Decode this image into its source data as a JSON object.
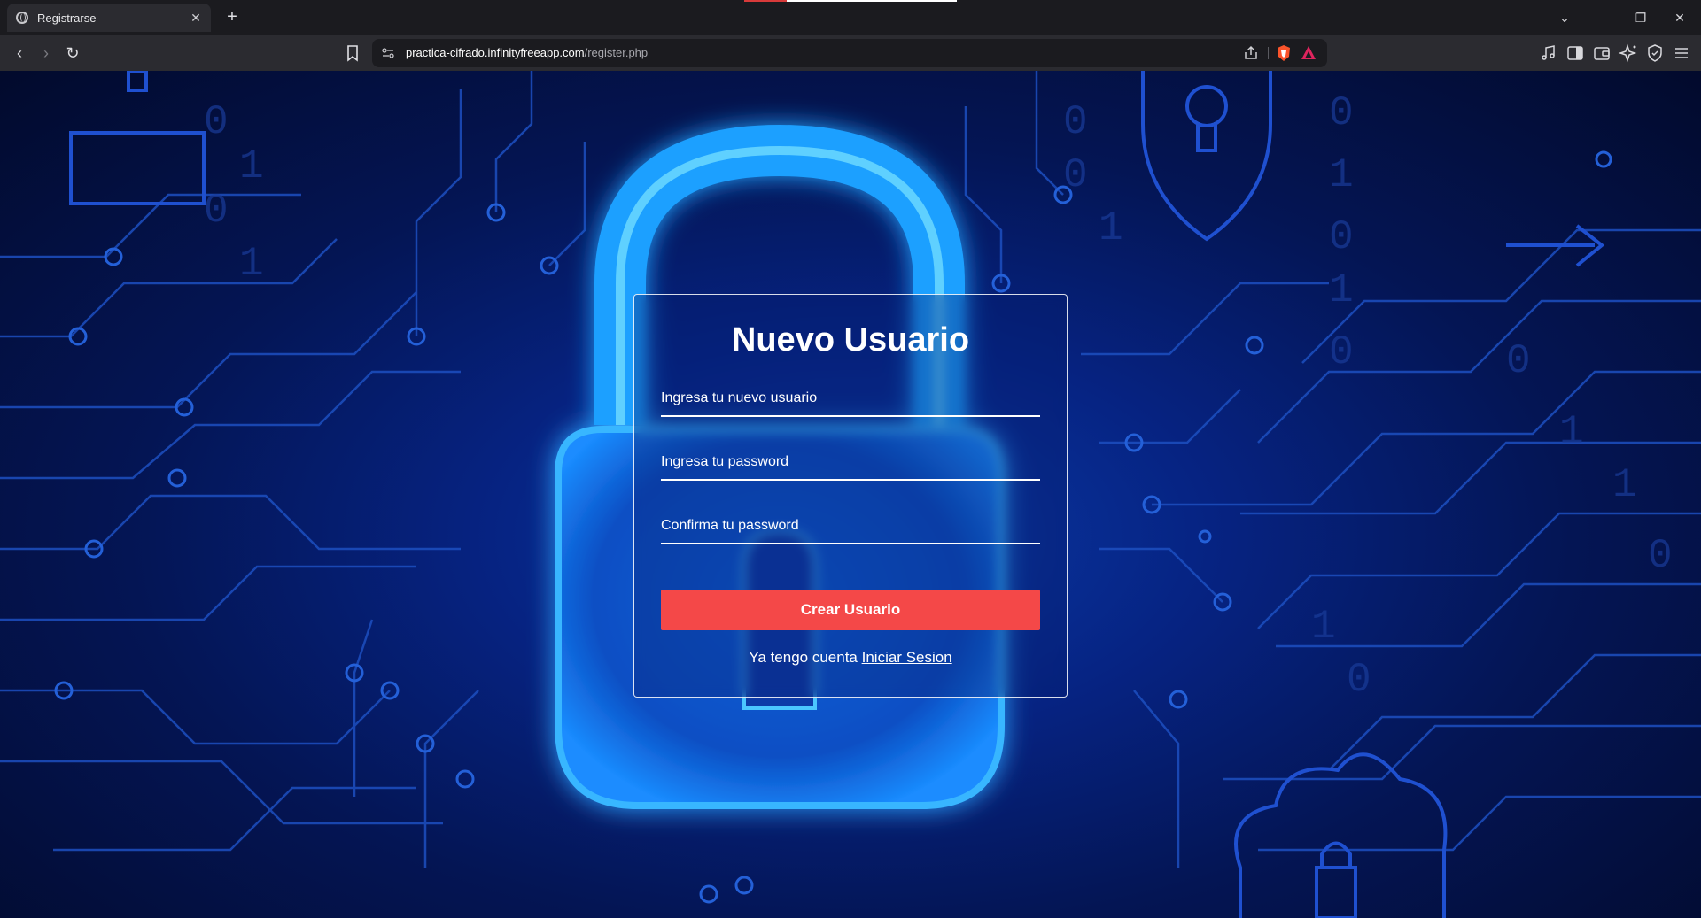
{
  "browser": {
    "tab": {
      "title": "Registrarse",
      "close_label": "✕"
    },
    "new_tab_label": "+",
    "window_controls": {
      "tab_search": "⌄",
      "minimize": "—",
      "restore": "❐",
      "close": "✕"
    },
    "nav": {
      "back": "‹",
      "forward": "›",
      "reload": "↻"
    },
    "url": {
      "host": "practica-cifrado.infinityfreeapp.com",
      "path": "/register.php"
    },
    "accent_colors": {
      "brave": "#fb542b",
      "rewards": "#e0245e"
    }
  },
  "form": {
    "title": "Nuevo Usuario",
    "username_placeholder": "Ingresa tu nuevo usuario",
    "password_placeholder": "Ingresa tu password",
    "confirm_placeholder": "Confirma tu password",
    "submit_label": "Crear Usuario",
    "login_prompt": "Ya tengo cuenta",
    "login_link": "Iniciar Sesion",
    "button_color": "#f44848"
  },
  "background": {
    "binary_digits": [
      "0",
      "1",
      "0",
      "1",
      "0",
      "0",
      "1",
      "0",
      "1",
      "0",
      "1",
      "0",
      "0",
      "1",
      "1",
      "0",
      "1",
      "0"
    ]
  }
}
